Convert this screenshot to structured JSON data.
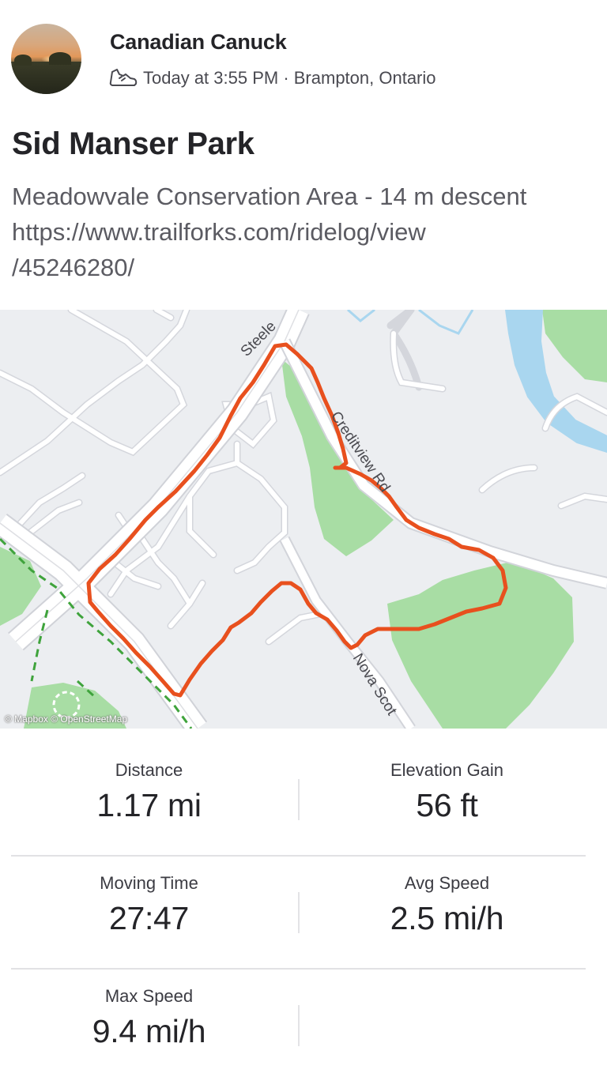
{
  "athlete": {
    "name": "Canadian Canuck",
    "activity_icon": "hiking-shoe-icon",
    "meta": "Today at 3:55 PM · Brampton, Ontario"
  },
  "activity": {
    "title": "Sid Manser Park",
    "description": "Meadowvale Conservation Area - 14 m descent\nhttps://www.trailforks.com/ridelog/view\n/45246280/"
  },
  "map": {
    "attribution": "© Mapbox © OpenStreetMap",
    "street_labels": [
      "Steele",
      "Creditview Rd",
      "Nova Scot"
    ],
    "route_color": "#e8501e",
    "park_color": "#a8dda4",
    "water_color": "#a9d6ef",
    "trail_color": "#3fa33c"
  },
  "stats": [
    {
      "label": "Distance",
      "value": "1.17 mi"
    },
    {
      "label": "Elevation Gain",
      "value": "56 ft"
    },
    {
      "label": "Moving Time",
      "value": "27:47"
    },
    {
      "label": "Avg Speed",
      "value": "2.5 mi/h"
    },
    {
      "label": "Max Speed",
      "value": "9.4 mi/h"
    }
  ]
}
